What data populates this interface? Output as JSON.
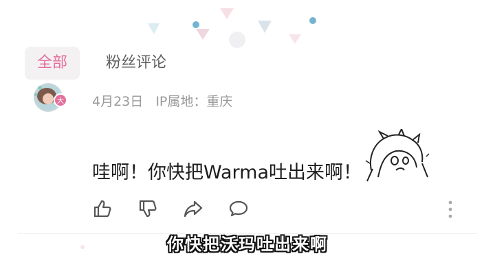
{
  "tabs": [
    {
      "label": "全部",
      "active": true
    },
    {
      "label": "粉丝评论",
      "active": false
    }
  ],
  "comment": {
    "date": "4月23日",
    "ip_location": "IP属地：重庆",
    "text": "哇啊！你快把Warma吐出来啊！",
    "avatar_badge_color": "#e46f9c",
    "sticker": "chibi-cry-sticker"
  },
  "actions": {
    "icons": [
      "thumbs-up-icon",
      "thumbs-down-icon",
      "share-icon",
      "reply-icon",
      "more-vertical-icon"
    ]
  },
  "subtitle": "你快把沃玛吐出来啊",
  "colors": {
    "accent": "#e46f9c",
    "tab_bg": "#f4f1f3",
    "meta": "#9a9a9a",
    "icon": "#555555"
  }
}
